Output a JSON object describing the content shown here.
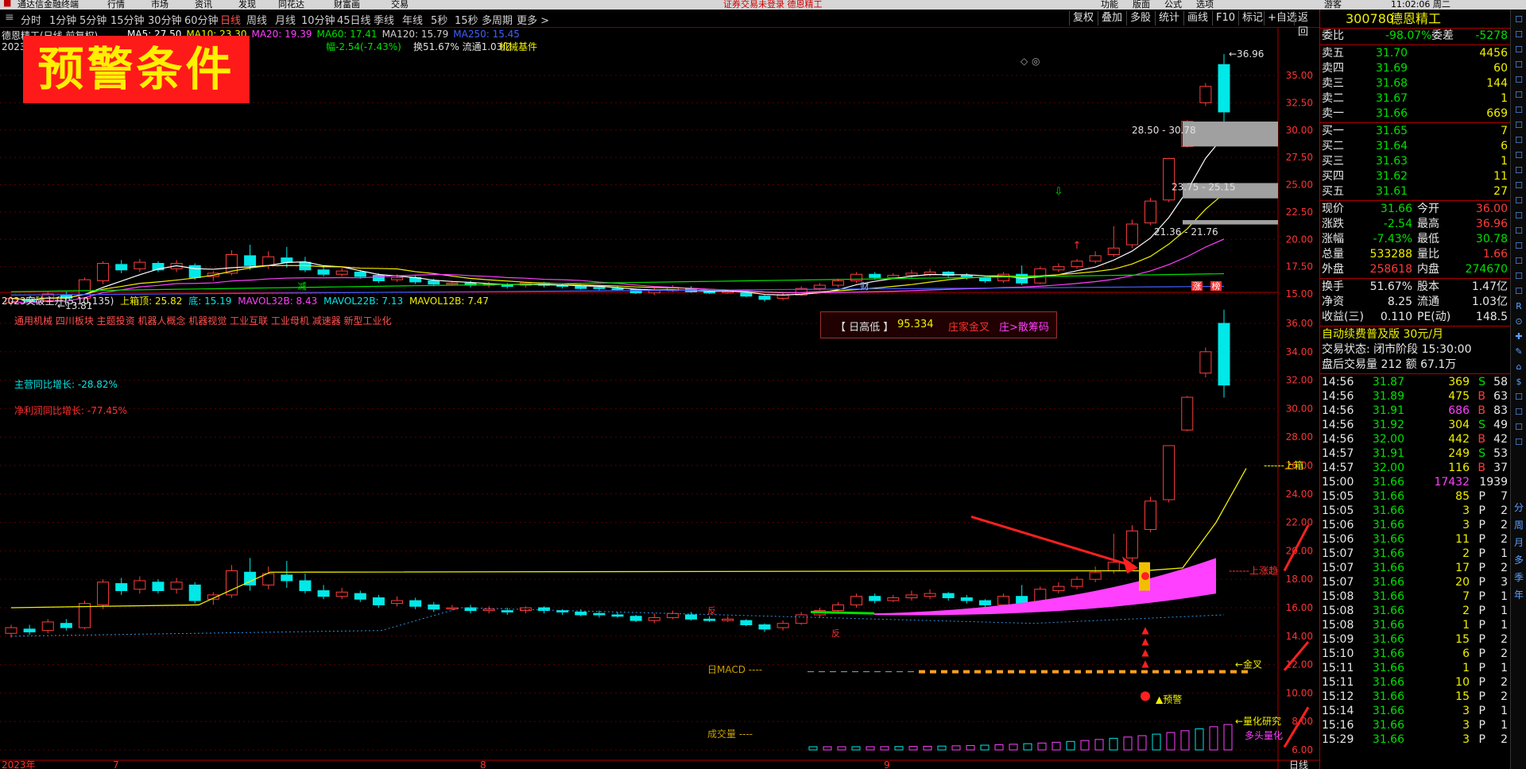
{
  "menubar": {
    "items": [
      "通达信金融终端",
      "行情",
      "市场",
      "资讯",
      "发现",
      "同花达",
      "财富画",
      "交易"
    ],
    "notice": "证券交易未登录  德恩精工",
    "right_items": [
      "功能",
      "版面",
      "公式",
      "选项"
    ],
    "clock": "11:02:06 周二",
    "mode": "游客"
  },
  "toolbar": {
    "periods": [
      "分时",
      "1分钟",
      "5分钟",
      "15分钟",
      "30分钟",
      "60分钟",
      "日线",
      "周线",
      "月线",
      "10分钟",
      "45日线",
      "季线",
      "年线",
      "5秒",
      "15秒",
      "多周期",
      "更多 >"
    ],
    "active": "日线",
    "right_buttons": [
      "复权",
      "叠加",
      "多股",
      "统计",
      "画线",
      "F10",
      "标记",
      "+自选",
      "返回"
    ]
  },
  "chart_header": {
    "stock_title": "德恩精工(日线,前复权)",
    "ma": [
      {
        "label": "MA5: 27.50",
        "color": "#ffffff"
      },
      {
        "label": "MA10: 23.30",
        "color": "#f0f000"
      },
      {
        "label": "MA20: 19.39",
        "color": "#ff40ff"
      },
      {
        "label": "MA60: 17.41",
        "color": "#00e000"
      },
      {
        "label": "MA120: 15.79",
        "color": "#d0d0d0"
      },
      {
        "label": "MA250: 15.45",
        "color": "#4060ff"
      }
    ],
    "line2": "2023   3  额17.7亿",
    "line2b": "幅-2.54(-7.43%)",
    "line2c": "换51.67% 流通1.03亿",
    "industry": "机械基件"
  },
  "banner": "预警条件",
  "price_labels": {
    "max": "36.96",
    "min": "13.81",
    "zone1": "28.50 - 30.78",
    "zone2": "23.75 - 25.15",
    "zone3": "21.36 - 21.76"
  },
  "upper_markers": [
    "减",
    "财",
    "涨",
    "榜"
  ],
  "upper_axis": [
    "35.00",
    "32.50",
    "30.00",
    "27.50",
    "25.00",
    "22.50",
    "20.00",
    "17.50",
    "15.00"
  ],
  "indicator": {
    "title": "2023突破主升(5,10,135)",
    "top": "上箱顶: 25.82",
    "bottom": "底: 15.19",
    "mavol32": "MAVOL32B: 8.43",
    "mavol22": "MAVOL22B: 7.13",
    "mavol12": "MAVOL12B: 7.47",
    "concepts": "通用机械 四川板块 主题投资 机器人概念 机器视觉 工业互联 工业母机 减速器 新型工业化",
    "revenue_label": "主营同比增长: -28.82%",
    "profit_label": "净利润同比增长: -77.45%",
    "macd_label": "日MACD  ----",
    "vol_label": "成交量  ----",
    "annots": {
      "up_break": "上涨趋",
      "jincha": "←金叉",
      "upper": "上箱",
      "quant": "←量化研究",
      "duotou": "多头量化",
      "alert": "▲预警",
      "fan1": "反",
      "fan2": "反"
    }
  },
  "alert_box": {
    "label": "【 日高低 】",
    "value": "95.334",
    "t1": "庄家金叉",
    "t2": "庄>散筹码"
  },
  "lower_axis": [
    "36.00",
    "34.00",
    "32.00",
    "30.00",
    "28.00",
    "26.00",
    "24.00",
    "22.00",
    "20.00",
    "18.00",
    "16.00",
    "14.00",
    "12.00",
    "10.00",
    "8.00",
    "6.00"
  ],
  "bottom_axis": [
    "2023年",
    "7",
    "8",
    "9"
  ],
  "bottom_right": "日线",
  "quote": {
    "code": "300780",
    "name": "德恩精工",
    "weibi_label": "委比",
    "weibi": "-98.07%",
    "weicha_label": "委差",
    "weicha": "-5278",
    "sells": [
      {
        "label": "卖五",
        "price": "31.70",
        "vol": "4456"
      },
      {
        "label": "卖四",
        "price": "31.69",
        "vol": "60"
      },
      {
        "label": "卖三",
        "price": "31.68",
        "vol": "144"
      },
      {
        "label": "卖二",
        "price": "31.67",
        "vol": "1"
      },
      {
        "label": "卖一",
        "price": "31.66",
        "vol": "669"
      }
    ],
    "buys": [
      {
        "label": "买一",
        "price": "31.65",
        "vol": "7"
      },
      {
        "label": "买二",
        "price": "31.64",
        "vol": "6"
      },
      {
        "label": "买三",
        "price": "31.63",
        "vol": "1"
      },
      {
        "label": "买四",
        "price": "31.62",
        "vol": "11"
      },
      {
        "label": "买五",
        "price": "31.61",
        "vol": "27"
      }
    ],
    "stats": [
      {
        "l1": "现价",
        "v1": "31.66",
        "l2": "今开",
        "v2": "36.00",
        "c1": "green",
        "c2": "red"
      },
      {
        "l1": "涨跌",
        "v1": "-2.54",
        "l2": "最高",
        "v2": "36.96",
        "c1": "green",
        "c2": "red"
      },
      {
        "l1": "涨幅",
        "v1": "-7.43%",
        "l2": "最低",
        "v2": "30.78",
        "c1": "green",
        "c2": "green"
      },
      {
        "l1": "总量",
        "v1": "533288",
        "l2": "量比",
        "v2": "1.66",
        "c1": "yellow",
        "c2": "red"
      },
      {
        "l1": "外盘",
        "v1": "258618",
        "l2": "内盘",
        "v2": "274670",
        "c1": "red",
        "c2": "green"
      }
    ],
    "stats2": [
      {
        "l1": "换手",
        "v1": "51.67%",
        "l2": "股本",
        "v2": "1.47亿"
      },
      {
        "l1": "净资",
        "v1": "8.25",
        "l2": "流通",
        "v2": "1.03亿"
      },
      {
        "l1": "收益(三)",
        "v1": "0.110",
        "l2": "PE(动)",
        "v2": "148.5"
      }
    ],
    "promo": "自动续费普及版  30元/月",
    "status": "交易状态: 闭市阶段 15:30:00",
    "after": "盘后交易量 212 额 67.1万",
    "ticks": [
      {
        "t": "14:56",
        "p": "31.87",
        "v": "369",
        "bs": "S",
        "n": "58"
      },
      {
        "t": "14:56",
        "p": "31.89",
        "v": "475",
        "bs": "B",
        "n": "63"
      },
      {
        "t": "14:56",
        "p": "31.91",
        "v": "686",
        "bs": "B",
        "n": "83"
      },
      {
        "t": "14:56",
        "p": "31.92",
        "v": "304",
        "bs": "S",
        "n": "49"
      },
      {
        "t": "14:56",
        "p": "32.00",
        "v": "442",
        "bs": "B",
        "n": "42"
      },
      {
        "t": "14:57",
        "p": "31.91",
        "v": "249",
        "bs": "S",
        "n": "53"
      },
      {
        "t": "14:57",
        "p": "32.00",
        "v": "116",
        "bs": "B",
        "n": "37"
      },
      {
        "t": "15:00",
        "p": "31.66",
        "v": "17432",
        "bs": "",
        "n": "1939"
      },
      {
        "t": "15:05",
        "p": "31.66",
        "v": "85",
        "bs": "P",
        "n": "7"
      },
      {
        "t": "15:05",
        "p": "31.66",
        "v": "3",
        "bs": "P",
        "n": "2"
      },
      {
        "t": "15:06",
        "p": "31.66",
        "v": "3",
        "bs": "P",
        "n": "2"
      },
      {
        "t": "15:06",
        "p": "31.66",
        "v": "11",
        "bs": "P",
        "n": "2"
      },
      {
        "t": "15:07",
        "p": "31.66",
        "v": "2",
        "bs": "P",
        "n": "1"
      },
      {
        "t": "15:07",
        "p": "31.66",
        "v": "17",
        "bs": "P",
        "n": "2"
      },
      {
        "t": "15:07",
        "p": "31.66",
        "v": "20",
        "bs": "P",
        "n": "3"
      },
      {
        "t": "15:08",
        "p": "31.66",
        "v": "7",
        "bs": "P",
        "n": "1"
      },
      {
        "t": "15:08",
        "p": "31.66",
        "v": "2",
        "bs": "P",
        "n": "1"
      },
      {
        "t": "15:08",
        "p": "31.66",
        "v": "1",
        "bs": "P",
        "n": "1"
      },
      {
        "t": "15:09",
        "p": "31.66",
        "v": "15",
        "bs": "P",
        "n": "2"
      },
      {
        "t": "15:10",
        "p": "31.66",
        "v": "6",
        "bs": "P",
        "n": "2"
      },
      {
        "t": "15:11",
        "p": "31.66",
        "v": "1",
        "bs": "P",
        "n": "1"
      },
      {
        "t": "15:11",
        "p": "31.66",
        "v": "10",
        "bs": "P",
        "n": "2"
      },
      {
        "t": "15:12",
        "p": "31.66",
        "v": "15",
        "bs": "P",
        "n": "2"
      },
      {
        "t": "15:14",
        "p": "31.66",
        "v": "3",
        "bs": "P",
        "n": "1"
      },
      {
        "t": "15:16",
        "p": "31.66",
        "v": "3",
        "bs": "P",
        "n": "1"
      },
      {
        "t": "15:29",
        "p": "31.66",
        "v": "3",
        "bs": "P",
        "n": "2"
      }
    ]
  },
  "side_icons": [
    "分",
    "周",
    "月",
    "多",
    "季",
    "年"
  ],
  "colors": {
    "up": "#ff3c3c",
    "down": "#00e8e8",
    "grid": "#b00000"
  }
}
